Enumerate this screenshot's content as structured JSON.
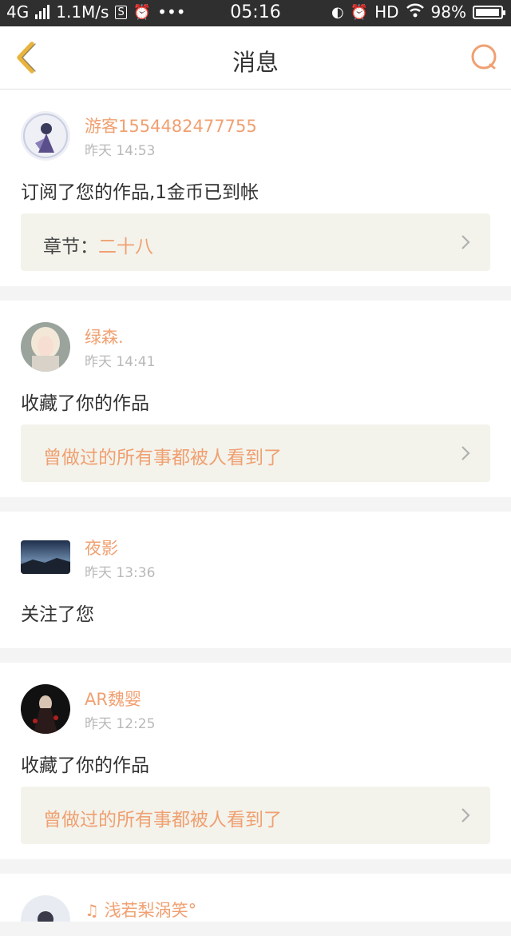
{
  "status_bar": {
    "network": "4G",
    "speed": "1.1M/s",
    "time": "05:16",
    "hd": "HD",
    "battery": "98%",
    "battery_level": 0.98
  },
  "header": {
    "title": "消息"
  },
  "messages": [
    {
      "user": "游客1554482477755",
      "time": "昨天 14:53",
      "action": "订阅了您的作品,1金币已到帐",
      "ref_label": "章节：",
      "ref_value": "二十八"
    },
    {
      "user": "绿森.",
      "time": "昨天 14:41",
      "action": "收藏了你的作品",
      "ref_label": "",
      "ref_value": "曾做过的所有事都被人看到了"
    },
    {
      "user": "夜影",
      "time": "昨天 13:36",
      "action": "关注了您"
    },
    {
      "user": "AR魏婴",
      "time": "昨天 12:25",
      "action": "收藏了你的作品",
      "ref_label": "",
      "ref_value": "曾做过的所有事都被人看到了"
    },
    {
      "user": "浅若梨涡笑°"
    }
  ],
  "colors": {
    "accent": "#f0a071",
    "statusbar": "#2f2f2f",
    "ref_bg": "#f3f3ec",
    "back_icon": "#e9b43d"
  }
}
